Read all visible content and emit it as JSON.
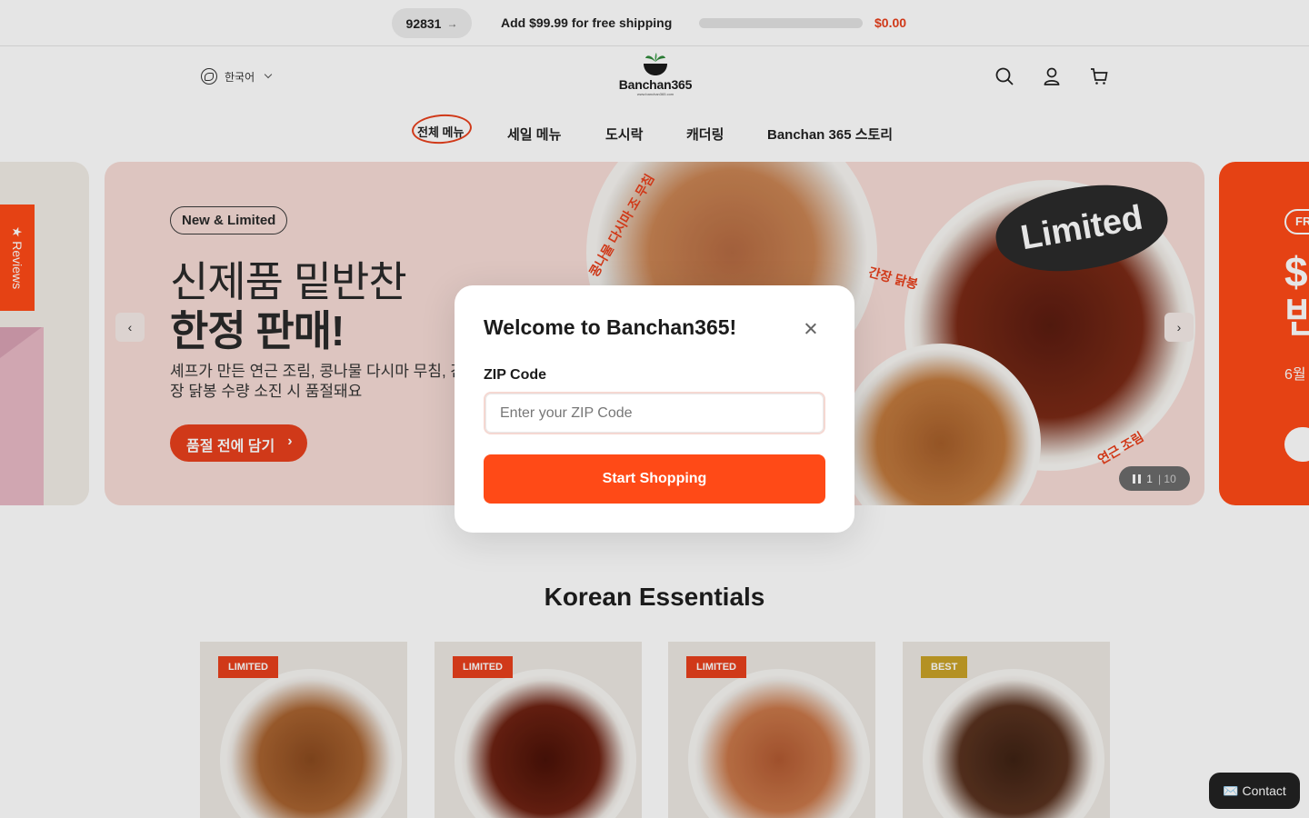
{
  "topbar": {
    "zip": "92831",
    "zip_arrow": "→",
    "shipping_message": "Add $99.99 for free shipping",
    "shipping_progress": 0,
    "shipping_amount": "$0.00"
  },
  "header": {
    "language": "한국어",
    "logo_name": "Banchan365",
    "logo_url": "www.banchan365.com",
    "icons": [
      "search-icon",
      "account-icon",
      "cart-icon"
    ]
  },
  "nav": {
    "items": [
      "전체 메뉴",
      "세일 메뉴",
      "도시락",
      "캐더링",
      "Banchan 365 스토리"
    ]
  },
  "hero": {
    "badge": "New & Limited",
    "line1": "신제품 밑반찬",
    "line2": "한정 판매!",
    "subtitle": "셰프가 만든 연근 조림, 콩나물 다시마 무침, 간장 닭봉 수량 소진 시 품절돼요",
    "cta": "품절 전에 담기",
    "limited_stamp": "Limited",
    "dish_label_1": "콩나물 다시마 조 무침",
    "dish_label_2": "간장 닭봉",
    "dish_label_3": "연근 조림",
    "counter_current": "1",
    "counter_total": "10",
    "prev_arrow": "‹",
    "next_arrow": "›",
    "next_slide_badge": "FR",
    "next_slide_big": "$ 반",
    "next_slide_small": "6월"
  },
  "reviews_tab": "★ Reviews",
  "section": {
    "title": "Korean Essentials",
    "products": [
      {
        "badge": "LIMITED",
        "color": "#e8401c"
      },
      {
        "badge": "LIMITED",
        "color": "#e8401c"
      },
      {
        "badge": "LIMITED",
        "color": "#e8401c"
      },
      {
        "badge": "BEST",
        "color": "#c9a227"
      }
    ]
  },
  "contact": {
    "label": "✉️ Contact"
  },
  "modal": {
    "title": "Welcome to Banchan365!",
    "zip_label": "ZIP Code",
    "zip_placeholder": "Enter your ZIP Code",
    "zip_value": "",
    "submit": "Start Shopping"
  },
  "colors": {
    "accent": "#ff4a17",
    "accent_dark": "#e8401c",
    "best_badge": "#c9a227"
  }
}
